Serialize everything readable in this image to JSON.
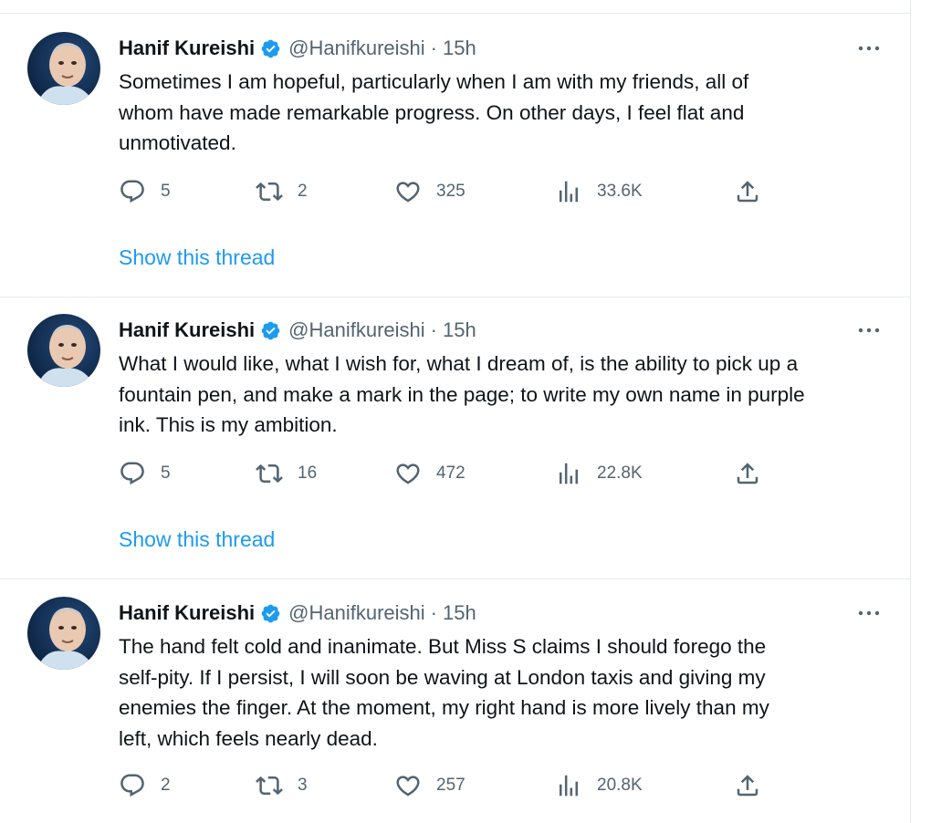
{
  "tweets": [
    {
      "author_name": "Hanif Kureishi",
      "handle": "@Hanifkureishi",
      "separator": "·",
      "time": "15h",
      "text": "Sometimes I am hopeful, particularly when I am with my friends, all of\nwhom have made remarkable progress. On other days, I feel flat and\nunmotivated.",
      "replies": "5",
      "retweets": "2",
      "likes": "325",
      "views": "33.6K",
      "show_thread": "Show this thread"
    },
    {
      "author_name": "Hanif Kureishi",
      "handle": "@Hanifkureishi",
      "separator": "·",
      "time": "15h",
      "text": "What I would like, what I wish for, what I dream of, is the ability to pick up a\nfountain pen, and make a mark in the page; to write my own name in purple\nink. This is my ambition.",
      "replies": "5",
      "retweets": "16",
      "likes": "472",
      "views": "22.8K",
      "show_thread": "Show this thread"
    },
    {
      "author_name": "Hanif Kureishi",
      "handle": "@Hanifkureishi",
      "separator": "·",
      "time": "15h",
      "text": "The hand felt cold and inanimate. But Miss S claims I should forego the\nself-pity. If I persist, I will soon be waving at London taxis and giving my\nenemies the finger. At the moment, my right hand is more lively than my\nleft, which feels nearly dead.",
      "replies": "2",
      "retweets": "3",
      "likes": "257",
      "views": "20.8K"
    }
  ],
  "icons": {
    "verified": "verified-badge-icon",
    "more": "more-options-icon",
    "reply": "reply-icon",
    "retweet": "retweet-icon",
    "like": "heart-icon",
    "views": "views-icon",
    "share": "share-icon"
  },
  "colors": {
    "accent": "#1d9bf0",
    "text": "#0f1419",
    "secondary": "#536471",
    "divider": "#e6ecf0"
  }
}
